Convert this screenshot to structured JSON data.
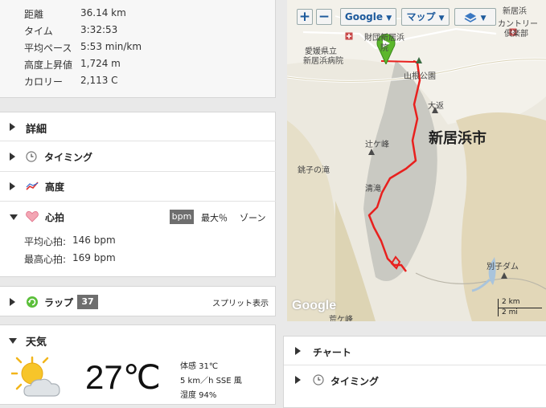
{
  "summary": {
    "items": [
      {
        "label": "距離",
        "value": "36.14 km"
      },
      {
        "label": "タイム",
        "value": "3:32:53"
      },
      {
        "label": "平均ペース",
        "value": "5:53 min/km"
      },
      {
        "label": "高度上昇値",
        "value": "1,724 m"
      },
      {
        "label": "カロリー",
        "value": "2,113 C"
      }
    ]
  },
  "sections": {
    "details": "詳細",
    "timing": "タイミング",
    "elevation": "高度",
    "heart_rate": "心拍"
  },
  "heart_rate": {
    "mode_bpm": "bpm",
    "mode_max": "最大％",
    "mode_zone": "ゾーン",
    "avg_label": "平均心拍:",
    "avg_value": "146 bpm",
    "max_label": "最高心拍:",
    "max_value": "169 bpm"
  },
  "laps": {
    "label": "ラップ",
    "count": "37",
    "split_view": "スプリット表示"
  },
  "weather": {
    "title": "天気",
    "temperature": "27℃",
    "feels_like": "体感 31℃",
    "wind": "5 km／h SSE 風",
    "humidity": "湿度 94%"
  },
  "map": {
    "zoom_in": "+",
    "zoom_out": "−",
    "provider": "Google",
    "map_type": "マップ",
    "city_label": "新居浜市",
    "places": [
      "新居浜",
      "カントリー",
      "倶楽部",
      "財団新居浜",
      "院",
      "愛媛県立",
      "新居浜病院",
      "山根公園",
      "大返",
      "辻ケ峰",
      "銚子の滝",
      "清滝",
      "別子ダム",
      "荒ケ峰"
    ],
    "scale_km": "2 km",
    "scale_mi": "2 mi",
    "watermark": "Google",
    "route_color": "#e8201e"
  },
  "bottom": {
    "chart": "チャート",
    "timing": "タイミング"
  }
}
